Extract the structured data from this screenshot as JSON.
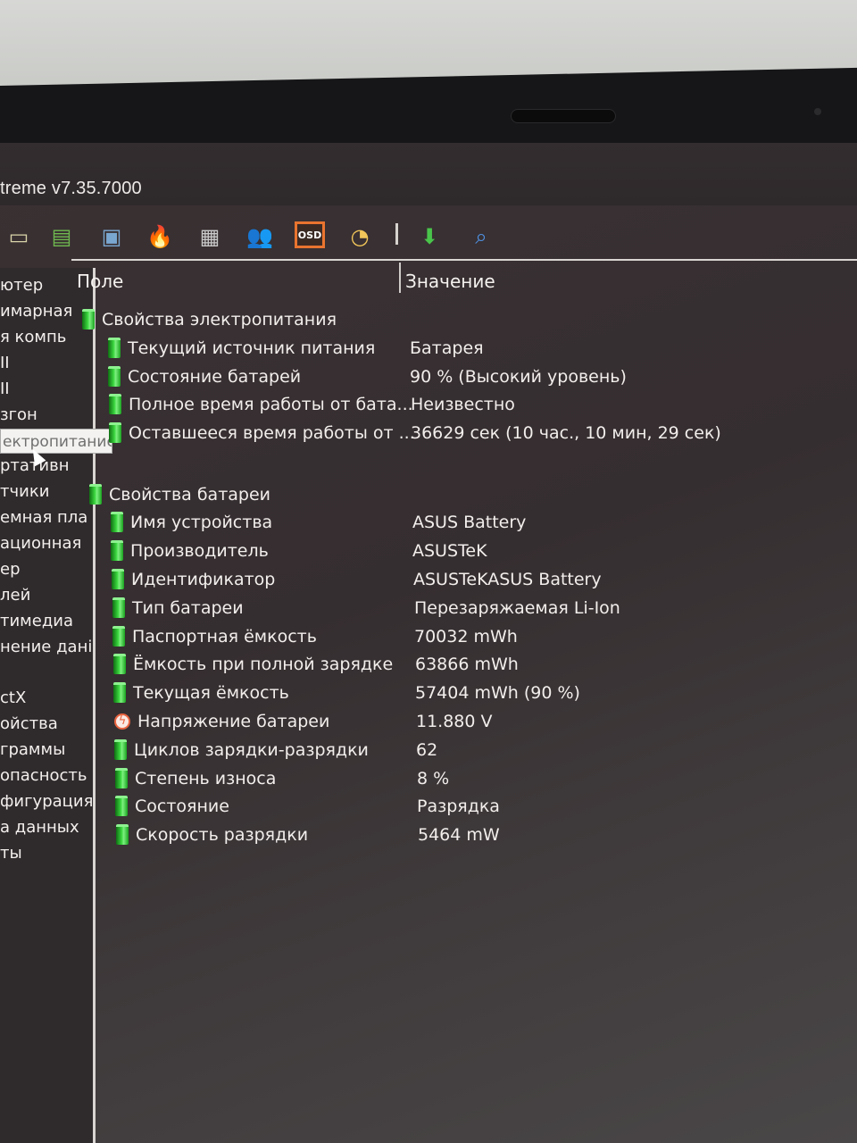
{
  "window": {
    "title": "treme v7.35.7000"
  },
  "toolbar": {
    "buttons": [
      {
        "name": "motherboard-icon",
        "glyph": "▭"
      },
      {
        "name": "memory-icon",
        "glyph": "▤"
      },
      {
        "name": "monitor-icon",
        "glyph": "▣"
      },
      {
        "name": "flame-icon",
        "glyph": "🔥"
      },
      {
        "name": "report-icon",
        "glyph": "▦"
      },
      {
        "name": "users-icon",
        "glyph": "👥"
      },
      {
        "name": "osd-icon",
        "glyph": "OSD"
      },
      {
        "name": "clock-icon",
        "glyph": "◔"
      },
      {
        "name": "download-arrow-icon",
        "glyph": "⬇"
      },
      {
        "name": "search-icon",
        "glyph": "⌕"
      }
    ]
  },
  "sidebar": {
    "items": [
      "ютер",
      "имарная",
      "я компь",
      "II",
      "II",
      "згон",
      "",
      "ртативн",
      "тчики",
      "емная пла",
      "ационная",
      "ер",
      "лей",
      "тимедиа",
      "нение дані",
      "",
      "ctX",
      "ойства",
      "граммы",
      "опасность",
      "фигурация",
      "а данных",
      "ты"
    ],
    "tooltip": "ектропитание"
  },
  "table": {
    "headers": {
      "field": "Поле",
      "value": "Значение"
    },
    "groups": [
      {
        "title": "Свойства электропитания",
        "rows": [
          {
            "icon": "batt",
            "field": "Текущий источник питания",
            "value": "Батарея"
          },
          {
            "icon": "batt",
            "field": "Состояние батарей",
            "value": "90 % (Высокий уровень)"
          },
          {
            "icon": "batt",
            "field": "Полное время работы от бата...",
            "value": "Неизвестно"
          },
          {
            "icon": "batt",
            "field": "Оставшееся время работы от ...",
            "value": "36629 сек (10 час., 10 мин, 29 сек)"
          }
        ]
      },
      {
        "title": "Свойства батареи",
        "rows": [
          {
            "icon": "batt",
            "field": "Имя устройства",
            "value": "ASUS Battery"
          },
          {
            "icon": "batt",
            "field": "Производитель",
            "value": "ASUSTeK"
          },
          {
            "icon": "batt",
            "field": "Идентификатор",
            "value": "ASUSTeKASUS Battery"
          },
          {
            "icon": "batt",
            "field": "Тип батареи",
            "value": "Перезаряжаемая Li-Ion"
          },
          {
            "icon": "batt",
            "field": "Паспортная ёмкость",
            "value": "70032 mWh"
          },
          {
            "icon": "batt",
            "field": "Ёмкость при полной зарядке",
            "value": "63866 mWh"
          },
          {
            "icon": "batt",
            "field": "Текущая ёмкость",
            "value": "57404 mWh  (90 %)"
          },
          {
            "icon": "bolt",
            "field": "Напряжение батареи",
            "value": "11.880 V"
          },
          {
            "icon": "batt",
            "field": "Циклов зарядки-разрядки",
            "value": "62"
          },
          {
            "icon": "batt",
            "field": "Степень износа",
            "value": "8 %"
          },
          {
            "icon": "batt",
            "field": "Состояние",
            "value": "Разрядка"
          },
          {
            "icon": "batt",
            "field": "Скорость разрядки",
            "value": "5464 mW"
          }
        ]
      }
    ]
  }
}
